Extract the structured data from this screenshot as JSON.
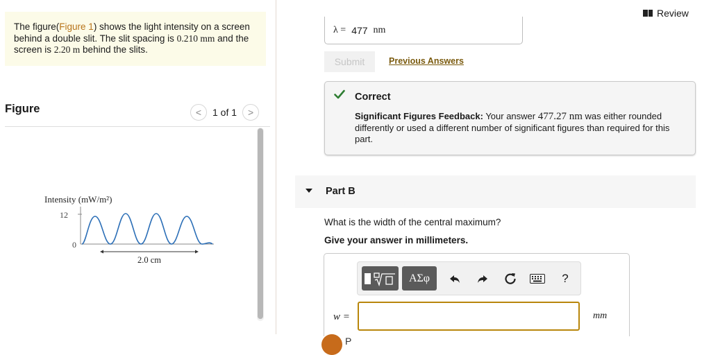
{
  "problem": {
    "text_before": "The figure(",
    "figure_link": "Figure 1",
    "text_after_link": ") shows the light intensity on a screen behind a double slit. The slit spacing is ",
    "slit_spacing": "0.210 mm",
    "text_mid": " and the screen is ",
    "screen_distance": "2.20 m",
    "text_end": " behind the slits."
  },
  "figure": {
    "heading": "Figure",
    "pager_prev": "<",
    "pager_text": "1 of 1",
    "pager_next": ">",
    "plot_ylabel": "Intensity (mW/m²)",
    "plot_ytick_top": "12",
    "plot_ytick_bottom": "0",
    "plot_span_label": "2.0 cm"
  },
  "review": {
    "label": "Review",
    "icon": "book-icon"
  },
  "part_a": {
    "answer_var": "λ =",
    "answer_value": "477",
    "answer_unit": "nm",
    "submit_label": "Submit",
    "previous_answers_label": "Previous Answers",
    "feedback_title": "Correct",
    "feedback_bold": "Significant Figures Feedback:",
    "feedback_pre": " Your answer ",
    "feedback_value": "477.27 nm",
    "feedback_post": " was either rounded differently or used a different number of significant figures than required for this part."
  },
  "part_b": {
    "title": "Part B",
    "question": "What is the width of the central maximum?",
    "instruction": "Give your answer in millimeters.",
    "toolbar": {
      "greek_label": "ΑΣφ",
      "help_label": "?"
    },
    "var_label": "w =",
    "unit": "mm",
    "input_value": ""
  },
  "footer": {
    "text": "P"
  },
  "colors": {
    "accent": "#b8860b",
    "link": "#b8741a",
    "correct": "#2e7d32",
    "panel": "#fcfbe8"
  }
}
